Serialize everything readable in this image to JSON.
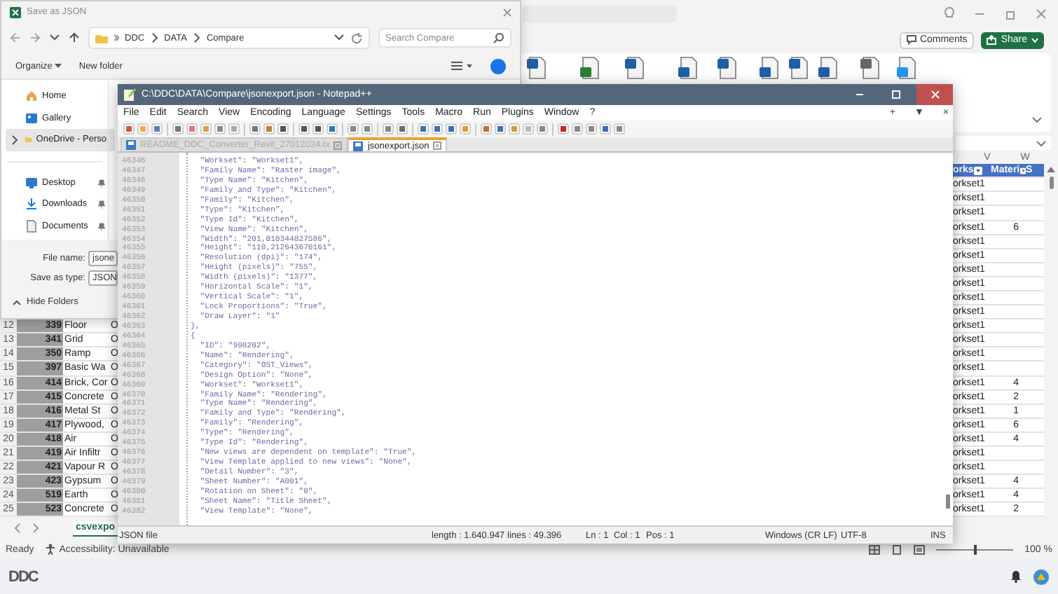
{
  "excel": {
    "comments_button": "Comments",
    "share_button": "Share",
    "columns": [
      "V",
      "W"
    ],
    "header": [
      "orks",
      "Materi",
      "S"
    ],
    "rows": [
      {
        "v": "orkset1"
      },
      {
        "v": "orkset1"
      },
      {
        "v": "orkset1"
      },
      {
        "v": "orkset1",
        "w": "6"
      },
      {
        "v": "orkset1"
      },
      {
        "v": "orkset1"
      },
      {
        "v": "orkset1"
      },
      {
        "v": "orkset1"
      },
      {
        "v": "orkset1"
      },
      {
        "v": "orkset1"
      },
      {
        "number": "12",
        "id": "339",
        "name": "Floor",
        "col_o": "O",
        "v": "orkset1"
      },
      {
        "number": "13",
        "id": "341",
        "name": "Grid",
        "col_o": "O",
        "v": "orkset1"
      },
      {
        "number": "14",
        "id": "350",
        "name": "Ramp",
        "col_o": "O",
        "v": "orkset1"
      },
      {
        "number": "15",
        "id": "397",
        "name": "Basic Wa",
        "col_o": "O",
        "v": "orkset1"
      },
      {
        "number": "16",
        "id": "414",
        "name": "Brick, Cor",
        "col_o": "O",
        "v": "orkset1",
        "w": "4"
      },
      {
        "number": "17",
        "id": "415",
        "name": "Concrete",
        "col_o": "O",
        "v": "orkset1",
        "w": "2"
      },
      {
        "number": "18",
        "id": "416",
        "name": "Metal St",
        "col_o": "O",
        "v": "orkset1",
        "w": "1"
      },
      {
        "number": "19",
        "id": "417",
        "name": "Plywood,",
        "col_o": "O",
        "v": "orkset1",
        "w": "6"
      },
      {
        "number": "20",
        "id": "418",
        "name": "Air",
        "col_o": "O",
        "v": "orkset1",
        "w": "4"
      },
      {
        "number": "21",
        "id": "419",
        "name": "Air Infiltr",
        "col_o": "O",
        "v": "orkset1"
      },
      {
        "number": "22",
        "id": "421",
        "name": "Vapour R",
        "col_o": "O",
        "v": "orkset1"
      },
      {
        "number": "23",
        "id": "423",
        "name": "Gypsum",
        "col_o": "O",
        "v": "orkset1",
        "w": "4"
      },
      {
        "number": "24",
        "id": "519",
        "name": "Earth",
        "col_o": "O",
        "v": "orkset1",
        "w": "4"
      },
      {
        "number": "25",
        "id": "523",
        "name": "Concrete",
        "col_o": "O",
        "v": "orkset1",
        "w": "2"
      }
    ],
    "sheet_tab": "csvexpo",
    "status": "Ready",
    "accessibility": "Accessibility: Unavailable",
    "zoom": "100 %",
    "zoom_slider": {
      "level": 0.5
    }
  },
  "save_dialog": {
    "title": "Save as JSON",
    "path": [
      "DDC",
      "DATA",
      "Compare"
    ],
    "search": {
      "placeholder": "Search Compare"
    },
    "organize": "Organize",
    "new_folder": "New folder",
    "nav_items": [
      {
        "label": "Home",
        "selected": false,
        "pinned": false
      },
      {
        "label": "Gallery",
        "selected": false,
        "pinned": false
      },
      {
        "label": "OneDrive - Perso",
        "selected": true,
        "pinned": false,
        "expanded": false
      },
      {
        "label": "Desktop",
        "selected": false,
        "pinned": true
      },
      {
        "label": "Downloads",
        "selected": false,
        "pinned": true
      },
      {
        "label": "Documents",
        "selected": false,
        "pinned": true
      }
    ],
    "file_name": {
      "label": "File name:",
      "value": "jsone"
    },
    "save_as_type": {
      "label": "Save as type:",
      "value": "JSON"
    },
    "hide_folders": "Hide Folders"
  },
  "notepad": {
    "title": "C:\\DDC\\DATA\\Compare\\jsonexport.json - Notepad++",
    "menu": [
      "File",
      "Edit",
      "Search",
      "View",
      "Encoding",
      "Language",
      "Settings",
      "Tools",
      "Macro",
      "Run",
      "Plugins",
      "Window",
      "?"
    ],
    "menu_controls": [
      "+",
      "▼",
      "×"
    ],
    "tabs": [
      {
        "label": "README_DDC_Converter_Revit_27012024.tx",
        "selected": false
      },
      {
        "label": "jsonexport.json",
        "selected": true
      }
    ],
    "lines": [
      {
        "number": "46346",
        "text": "  \"Workset\": \"Workset1\","
      },
      {
        "number": "46347",
        "text": "  \"Family Name\": \"Raster image\","
      },
      {
        "number": "46348",
        "text": "  \"Type Name\": \"Kitchen\","
      },
      {
        "number": "46349",
        "text": "  \"Family and Type\": \"Kitchen\","
      },
      {
        "number": "46350",
        "text": "  \"Family\": \"Kitchen\","
      },
      {
        "number": "46351",
        "text": "  \"Type\": \"Kitchen\","
      },
      {
        "number": "46352",
        "text": "  \"Type Id\": \"Kitchen\","
      },
      {
        "number": "46353",
        "text": "  \"View Name\": \"Kitchen\","
      },
      {
        "number": "46354",
        "text": "  \"Width\": \"201,010344827586\","
      },
      {
        "number": "46355",
        "text": "  \"Height\": \"110,212643670161\","
      },
      {
        "number": "46356",
        "text": "  \"Resolution (dpi)\": \"174\","
      },
      {
        "number": "46357",
        "text": "  \"Height (pixels)\": \"755\","
      },
      {
        "number": "46358",
        "text": "  \"Width (pixels)\": \"1377\","
      },
      {
        "number": "46359",
        "text": "  \"Horizontal Scale\": \"1\","
      },
      {
        "number": "46360",
        "text": "  \"Vertical Scale\": \"1\","
      },
      {
        "number": "46361",
        "text": "  \"Lock Proportions\": \"True\","
      },
      {
        "number": "46362",
        "text": "  \"Draw Layer\": \"1\""
      },
      {
        "number": "46363",
        "text": "},"
      },
      {
        "number": "46364",
        "text": "{"
      },
      {
        "number": "46365",
        "text": "  \"ID\": \"998202\","
      },
      {
        "number": "46366",
        "text": "  \"Name\": \"Rendering\","
      },
      {
        "number": "46367",
        "text": "  \"Category\": \"OST_Views\","
      },
      {
        "number": "46368",
        "text": "  \"Design Option\": \"None\","
      },
      {
        "number": "46369",
        "text": "  \"Workset\": \"Workset1\","
      },
      {
        "number": "46370",
        "text": "  \"Family Name\": \"Rendering\","
      },
      {
        "number": "46371",
        "text": "  \"Type Name\": \"Rendering\","
      },
      {
        "number": "46372",
        "text": "  \"Family and Type\": \"Rendering\","
      },
      {
        "number": "46373",
        "text": "  \"Family\": \"Rendering\","
      },
      {
        "number": "46374",
        "text": "  \"Type\": \"Rendering\","
      },
      {
        "number": "46375",
        "text": "  \"Type Id\": \"Rendering\","
      },
      {
        "number": "46376",
        "text": "  \"New views are dependent on template\": \"True\","
      },
      {
        "number": "46377",
        "text": "  \"View Template applied to new views\": \"None\","
      },
      {
        "number": "46378",
        "text": "  \"Detail Number\": \"3\","
      },
      {
        "number": "46379",
        "text": "  \"Sheet Number\": \"A001\","
      },
      {
        "number": "46380",
        "text": "  \"Rotation on Sheet\": \"0\","
      },
      {
        "number": "46381",
        "text": "  \"Sheet Name\": \"Title Sheet\","
      },
      {
        "number": "46382",
        "text": "  \"View Template\": \"None\","
      }
    ],
    "status": {
      "file_type": "JSON file",
      "length": "length : 1.640.947",
      "lines": "lines : 49.396",
      "ln": "Ln : 1",
      "col": "Col : 1",
      "pos": "Pos : 1",
      "eol": "Windows (CR LF)",
      "encoding": "UTF-8",
      "mode": "INS"
    }
  },
  "taskbar": {
    "logo": "DDC"
  }
}
